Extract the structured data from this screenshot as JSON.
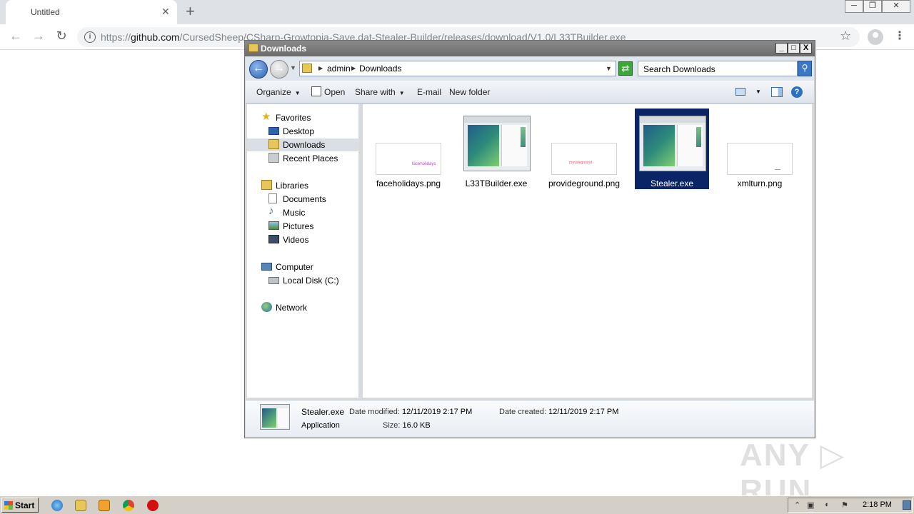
{
  "browser": {
    "tab_title": "Untitled",
    "tab_close": "✕",
    "new_tab": "+",
    "url_prefix": "https://",
    "url_host": "github.com",
    "url_path": "/CursedSheep/CSharp-Growtopia-Save.dat-Stealer-Builder/releases/download/V1.0/L33TBuilder.exe",
    "window_min": "─",
    "window_restore": "❐",
    "window_close": "✕"
  },
  "explorer": {
    "title": "Downloads",
    "breadcrumb": [
      "admin",
      "Downloads"
    ],
    "search_placeholder": "Search Downloads",
    "commands": {
      "organize": "Organize",
      "open": "Open",
      "share_with": "Share with",
      "email": "E-mail",
      "new_folder": "New folder"
    },
    "nav": {
      "favorites": "Favorites",
      "desktop": "Desktop",
      "downloads": "Downloads",
      "recent_places": "Recent Places",
      "libraries": "Libraries",
      "documents": "Documents",
      "music": "Music",
      "pictures": "Pictures",
      "videos": "Videos",
      "computer": "Computer",
      "local_disk": "Local Disk (C:)",
      "network": "Network"
    },
    "files": [
      {
        "name": "faceholidays.png",
        "thumb_text": "faceholidays",
        "thumb_color": "#c63ccf"
      },
      {
        "name": "L33TBuilder.exe"
      },
      {
        "name": "provideground.png",
        "thumb_text": "provideground",
        "thumb_color": "#e05a6a"
      },
      {
        "name": "Stealer.exe",
        "selected": true
      },
      {
        "name": "xmlturn.png"
      }
    ],
    "details": {
      "name": "Stealer.exe",
      "type": "Application",
      "date_modified_label": "Date modified:",
      "date_modified": "12/11/2019 2:17 PM",
      "date_created_label": "Date created:",
      "date_created": "12/11/2019 2:17 PM",
      "size_label": "Size:",
      "size": "16.0 KB"
    }
  },
  "watermark": "ANY ▷ RUN",
  "taskbar": {
    "start": "Start",
    "clock": "2:18 PM"
  },
  "colors": {
    "selection": "#0b2466",
    "title_bar": "#6c6c6c",
    "taskbar": "#d4d0c8"
  }
}
